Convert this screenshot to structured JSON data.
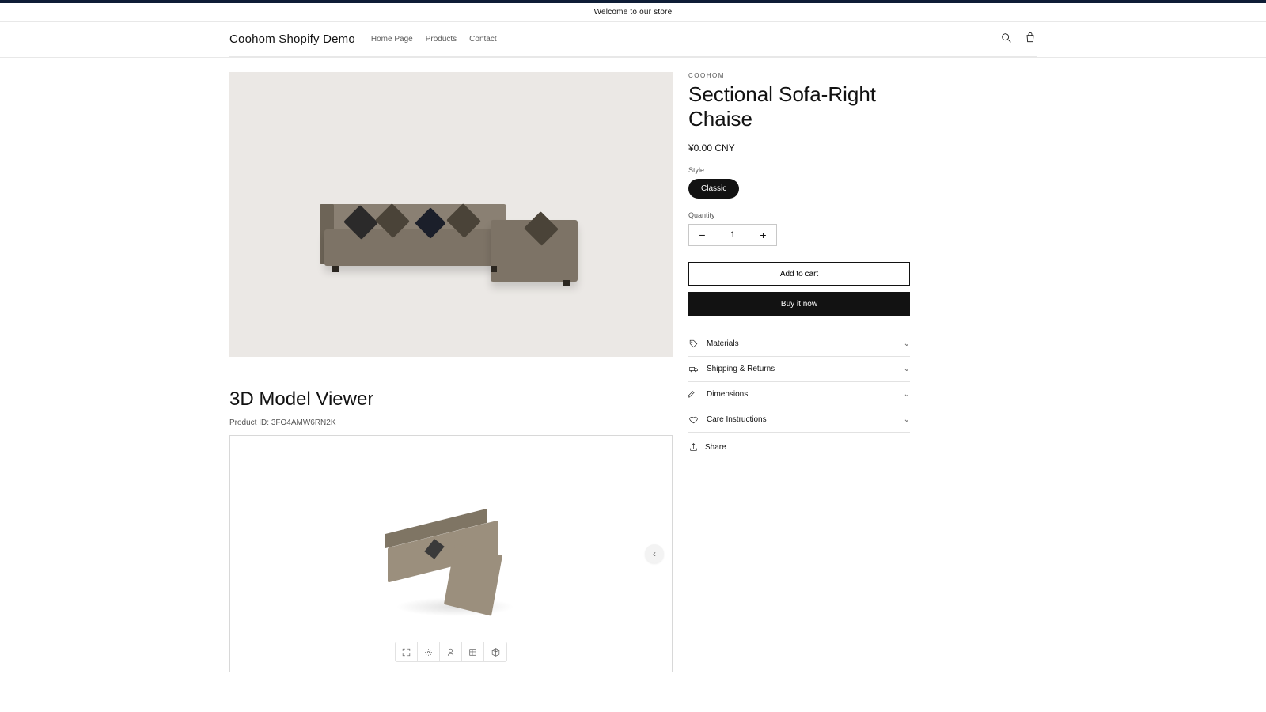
{
  "announcement": "Welcome to our store",
  "brand": "Coohom Shopify Demo",
  "nav": {
    "home": "Home Page",
    "products": "Products",
    "contact": "Contact"
  },
  "product": {
    "vendor": "COOHOM",
    "title": "Sectional Sofa-Right Chaise",
    "price": "¥0.00 CNY",
    "style_label": "Style",
    "style_value": "Classic",
    "qty_label": "Quantity",
    "qty_value": "1",
    "add_cart": "Add to cart",
    "buy_now": "Buy it now",
    "share": "Share"
  },
  "accordion": {
    "materials": "Materials",
    "shipping": "Shipping & Returns",
    "dimensions": "Dimensions",
    "care": "Care Instructions"
  },
  "viewer": {
    "title": "3D Model Viewer",
    "id_label": "Product ID:",
    "id_value": "3FO4AMW6RN2K"
  }
}
